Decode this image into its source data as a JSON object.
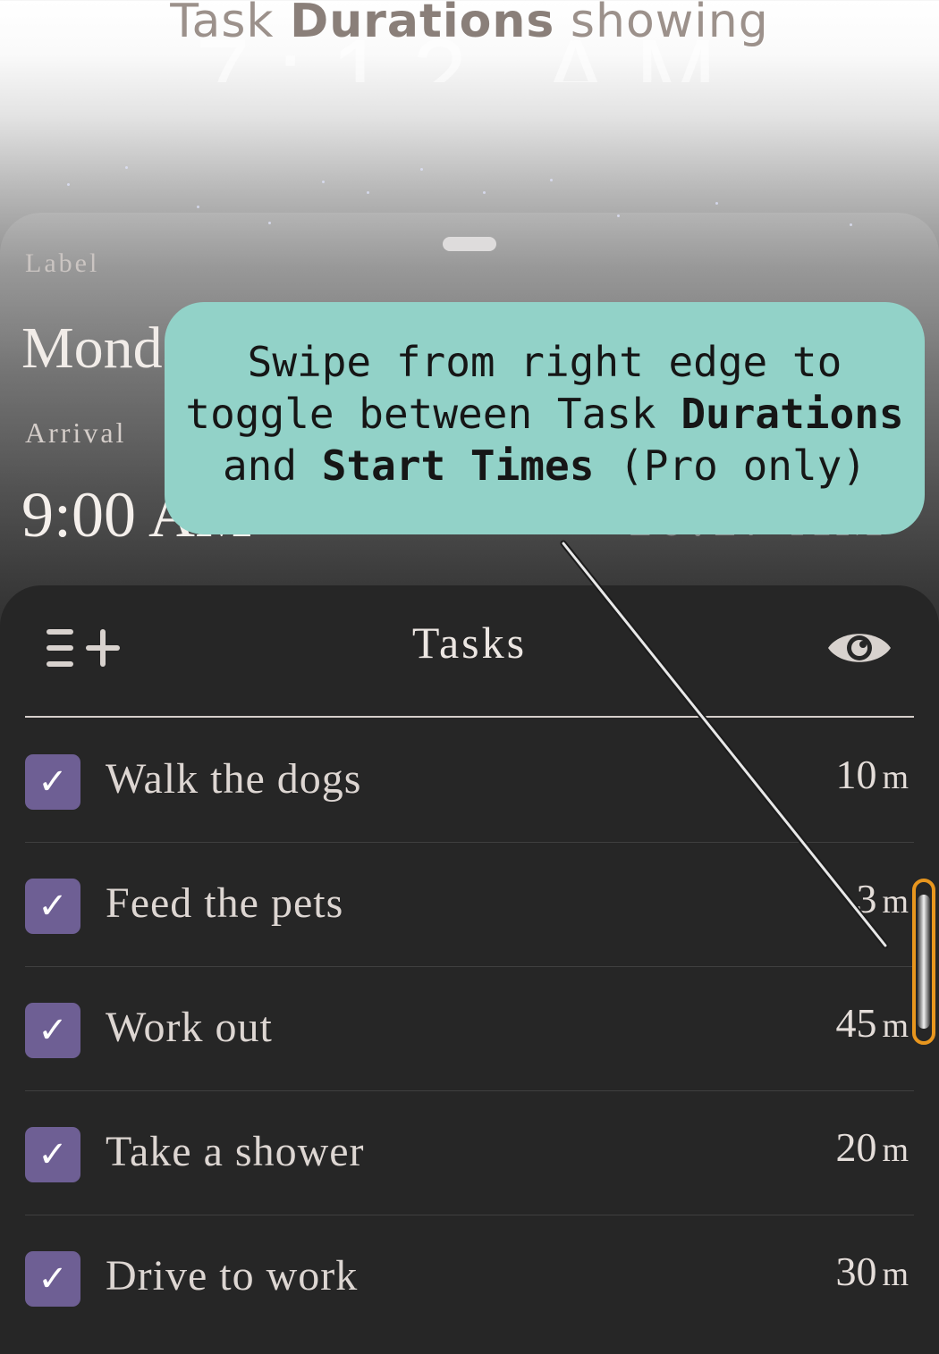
{
  "caption": {
    "prefix": "Task",
    "bold": "Durations",
    "suffix": "showing"
  },
  "background_clock": "7:12 AM",
  "routine": {
    "label_caption": "Label",
    "label_value": "Monday",
    "arrival_caption": "Arrival",
    "arrival_value": "9:00 AM",
    "right_value": "10:17 AM"
  },
  "callout": {
    "line1": "Swipe from right edge to",
    "line2_prefix": "toggle between Task",
    "line2_bold": "Durations",
    "line3_prefix": "and",
    "line3_bold": "Start Times",
    "line3_suffix": "(Pro only)",
    "background_color": "#92d2c8"
  },
  "tasks": {
    "title": "Tasks",
    "add_icon": "list-add-icon",
    "visibility_icon": "eye-icon",
    "checkbox_color": "#6e5f94",
    "items": [
      {
        "name": "Walk the dogs",
        "duration": "10",
        "unit": "m",
        "checked": true
      },
      {
        "name": "Feed the pets",
        "duration": "3",
        "unit": "m",
        "checked": true
      },
      {
        "name": "Work out",
        "duration": "45",
        "unit": "m",
        "checked": true
      },
      {
        "name": "Take a shower",
        "duration": "20",
        "unit": "m",
        "checked": true
      },
      {
        "name": "Drive to work",
        "duration": "30",
        "unit": "m",
        "checked": true
      }
    ]
  },
  "swipe_handle": {
    "highlight_color": "#e8961e"
  }
}
